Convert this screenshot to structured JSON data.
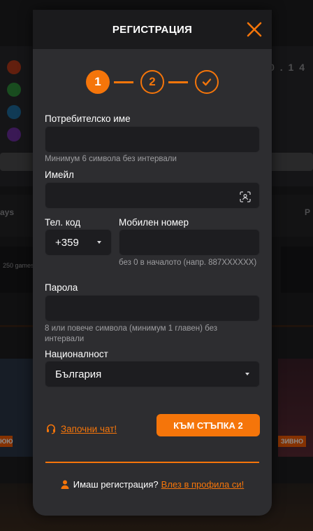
{
  "modal": {
    "title": "РЕГИСТРАЦИЯ",
    "close_icon": "close-icon"
  },
  "stepper": {
    "steps": [
      "1",
      "2",
      "✓"
    ],
    "active_step": 1,
    "accent_color": "#f5750a"
  },
  "form": {
    "username": {
      "label": "Потребителско име",
      "value": "",
      "placeholder": "",
      "hint": "Минимум 6 символа без интервали"
    },
    "email": {
      "label": "Имейл",
      "value": "",
      "placeholder": "",
      "icon": "scan-icon"
    },
    "phone_code": {
      "label": "Тел. код",
      "value": "+359"
    },
    "mobile": {
      "label": "Мобилен номер",
      "value": "",
      "placeholder": "",
      "hint": "без 0 в началото (напр. 887XXXXXX)"
    },
    "password": {
      "label": "Парола",
      "value": "",
      "placeholder": "",
      "hint": "8 или повече символа (минимум 1 главен) без интервали"
    },
    "nationality": {
      "label": "Националност",
      "value": "България"
    }
  },
  "actions": {
    "chat_label": "Започни чат!",
    "next_label": "КЪМ СТЪПКА 2"
  },
  "footer": {
    "question": "Имаш регистрация?",
    "login_link": "Влез в профила си!"
  },
  "background": {
    "score_text": "0 . 1 4",
    "left_label": "ays",
    "right_label": "P",
    "tile_text": "250 games",
    "badge_left": "ЮЮ",
    "badge_right": "ЗИВНО"
  },
  "colors": {
    "accent": "#f5750a",
    "modal_bg": "#2d2d30",
    "header_bg": "#1b1b1d",
    "field_bg": "#1d1d20"
  }
}
